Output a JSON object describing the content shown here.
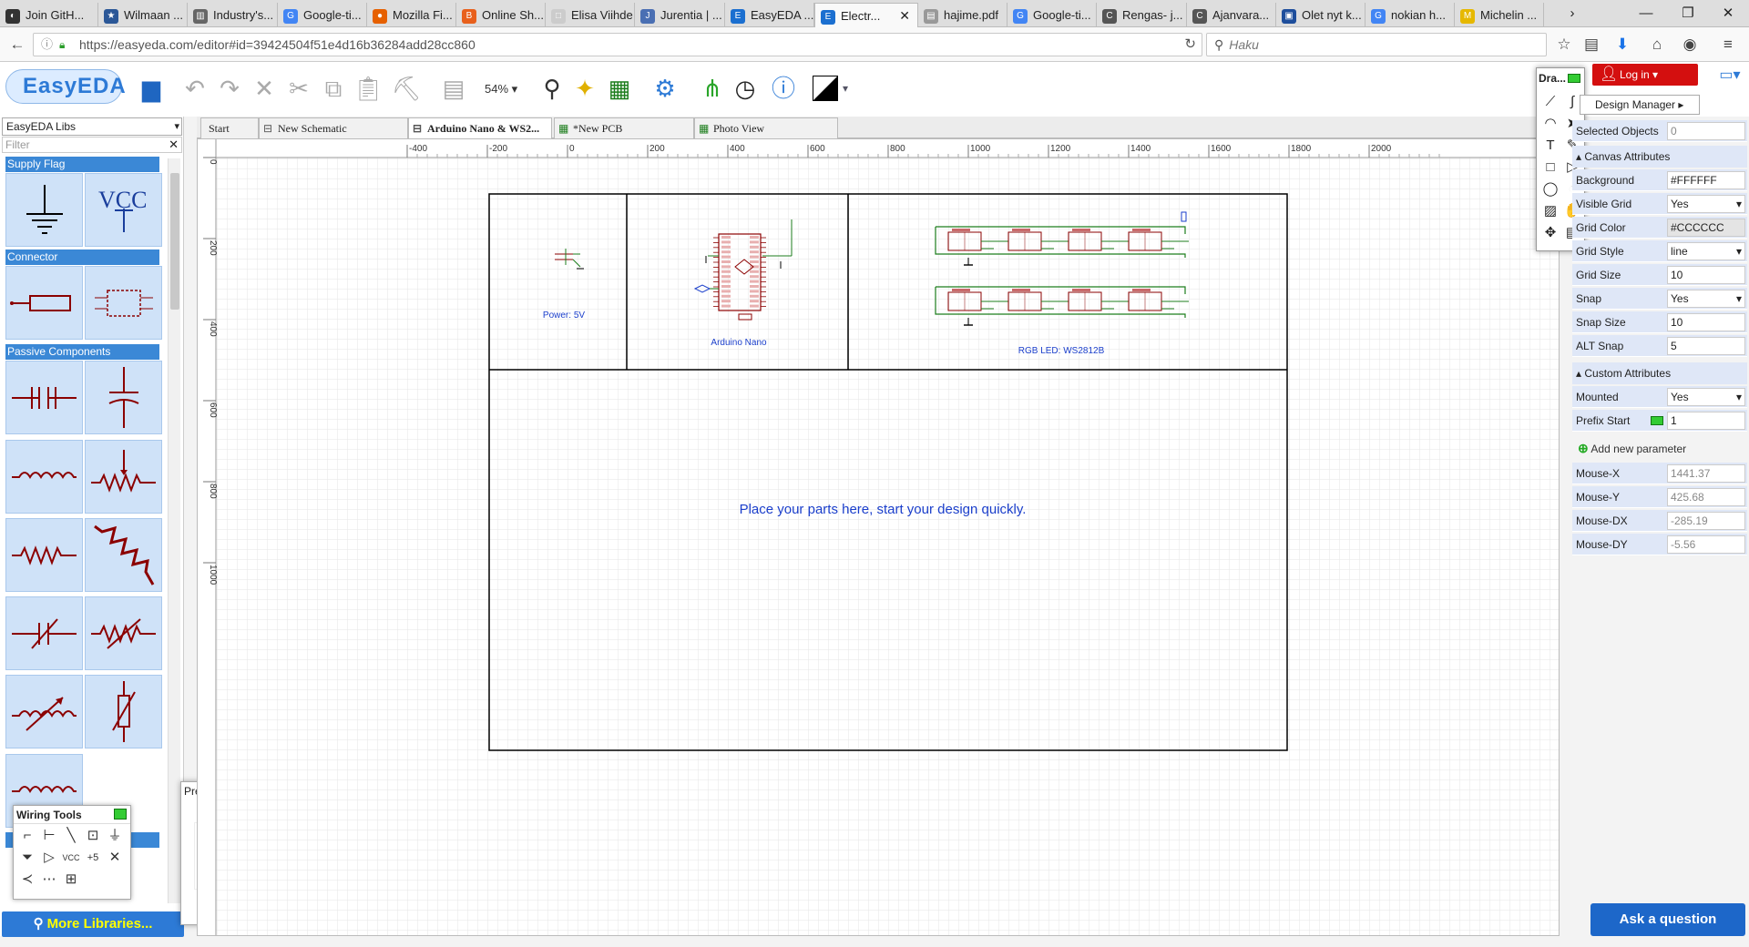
{
  "browser": {
    "tabs": [
      {
        "label": "Join GitH...",
        "icon": "github-icon",
        "color": "#333333"
      },
      {
        "label": "Wilmaan ...",
        "icon": "star-icon",
        "color": "#2b5797"
      },
      {
        "label": "Industry's...",
        "icon": "industry-icon",
        "color": "#666666"
      },
      {
        "label": "Google-ti...",
        "icon": "google-icon",
        "color": "#4285f4"
      },
      {
        "label": "Mozilla Fi...",
        "icon": "firefox-icon",
        "color": "#e66000"
      },
      {
        "label": "Online Sh...",
        "icon": "bg-icon",
        "color": "#e8601c"
      },
      {
        "label": "Elisa Viihde",
        "icon": "elisa-icon",
        "color": "#cccccc"
      },
      {
        "label": "Jurentia | ...",
        "icon": "jurentia-icon",
        "color": "#4a6fb3"
      },
      {
        "label": "EasyEDA ...",
        "icon": "easyeda-icon",
        "color": "#1b6fd0"
      },
      {
        "label": "Electr...",
        "icon": "easyeda-icon",
        "color": "#1b6fd0"
      },
      {
        "label": "hajime.pdf",
        "icon": "pdf-icon",
        "color": "#999999"
      },
      {
        "label": "Google-ti...",
        "icon": "google-icon",
        "color": "#4285f4"
      },
      {
        "label": "Rengas- j...",
        "icon": "page-icon",
        "color": "#555555"
      },
      {
        "label": "Ajanvara...",
        "icon": "page-icon",
        "color": "#555555"
      },
      {
        "label": "Olet nyt k...",
        "icon": "page-icon",
        "color": "#1e4e9c"
      },
      {
        "label": "nokian h...",
        "icon": "google-icon",
        "color": "#4285f4"
      },
      {
        "label": "Michelin ...",
        "icon": "michelin-icon",
        "color": "#e6b800"
      }
    ],
    "url": "https://easyeda.com/editor#id=39424504f51e4d16b36284add28cc860",
    "search_placeholder": "Haku"
  },
  "app": {
    "logo": "EasyEDA",
    "zoom": "54%",
    "login": "Log in"
  },
  "left_panel": {
    "lib_select": "EasyEDA Libs",
    "filter_placeholder": "Filter",
    "categories": [
      "Supply Flag",
      "Connector",
      "Passive Components"
    ],
    "vcc_label": "VCC",
    "more_libraries": "More Libraries..."
  },
  "wiring_tools": {
    "title": "Wiring Tools"
  },
  "preview": {
    "title": "Preview"
  },
  "doc_tabs": [
    "Start",
    "New Schematic",
    "Arduino Nano & WS2...",
    "*New PCB",
    "Photo View"
  ],
  "canvas": {
    "ruler_x": [
      "-400",
      "-200",
      "0",
      "200",
      "400",
      "600",
      "800",
      "1000",
      "1200",
      "1400",
      "1600",
      "1800",
      "2000"
    ],
    "ruler_y": [
      "0",
      "200",
      "400",
      "600",
      "800",
      "1000"
    ],
    "block_power": "Power: 5V",
    "block_arduino": "Arduino Nano",
    "block_led": "RGB LED: WS2812B",
    "placeholder": "Place your parts here, start your design quickly."
  },
  "draw_panel": {
    "title": "Dra..."
  },
  "right_panel": {
    "design_manager": "Design Manager",
    "selected_objects": {
      "label": "Selected Objects",
      "value": "0"
    },
    "canvas_section": "Canvas Attributes",
    "canvas_attrs": [
      {
        "label": "Background",
        "value": "#FFFFFF"
      },
      {
        "label": "Visible Grid",
        "value": "Yes"
      },
      {
        "label": "Grid Color",
        "value": "#CCCCCC"
      },
      {
        "label": "Grid Style",
        "value": "line"
      },
      {
        "label": "Grid Size",
        "value": "10"
      },
      {
        "label": "Snap",
        "value": "Yes"
      },
      {
        "label": "Snap Size",
        "value": "10"
      },
      {
        "label": "ALT Snap",
        "value": "5"
      }
    ],
    "custom_section": "Custom Attributes",
    "custom_attrs": [
      {
        "label": "Mounted",
        "value": "Yes"
      },
      {
        "label": "Prefix Start",
        "value": "1"
      }
    ],
    "add_param": "Add new parameter",
    "mouse": [
      {
        "label": "Mouse-X",
        "value": "1441.37"
      },
      {
        "label": "Mouse-Y",
        "value": "425.68"
      },
      {
        "label": "Mouse-DX",
        "value": "-285.19"
      },
      {
        "label": "Mouse-DY",
        "value": "-5.56"
      }
    ],
    "ask": "Ask a question"
  }
}
